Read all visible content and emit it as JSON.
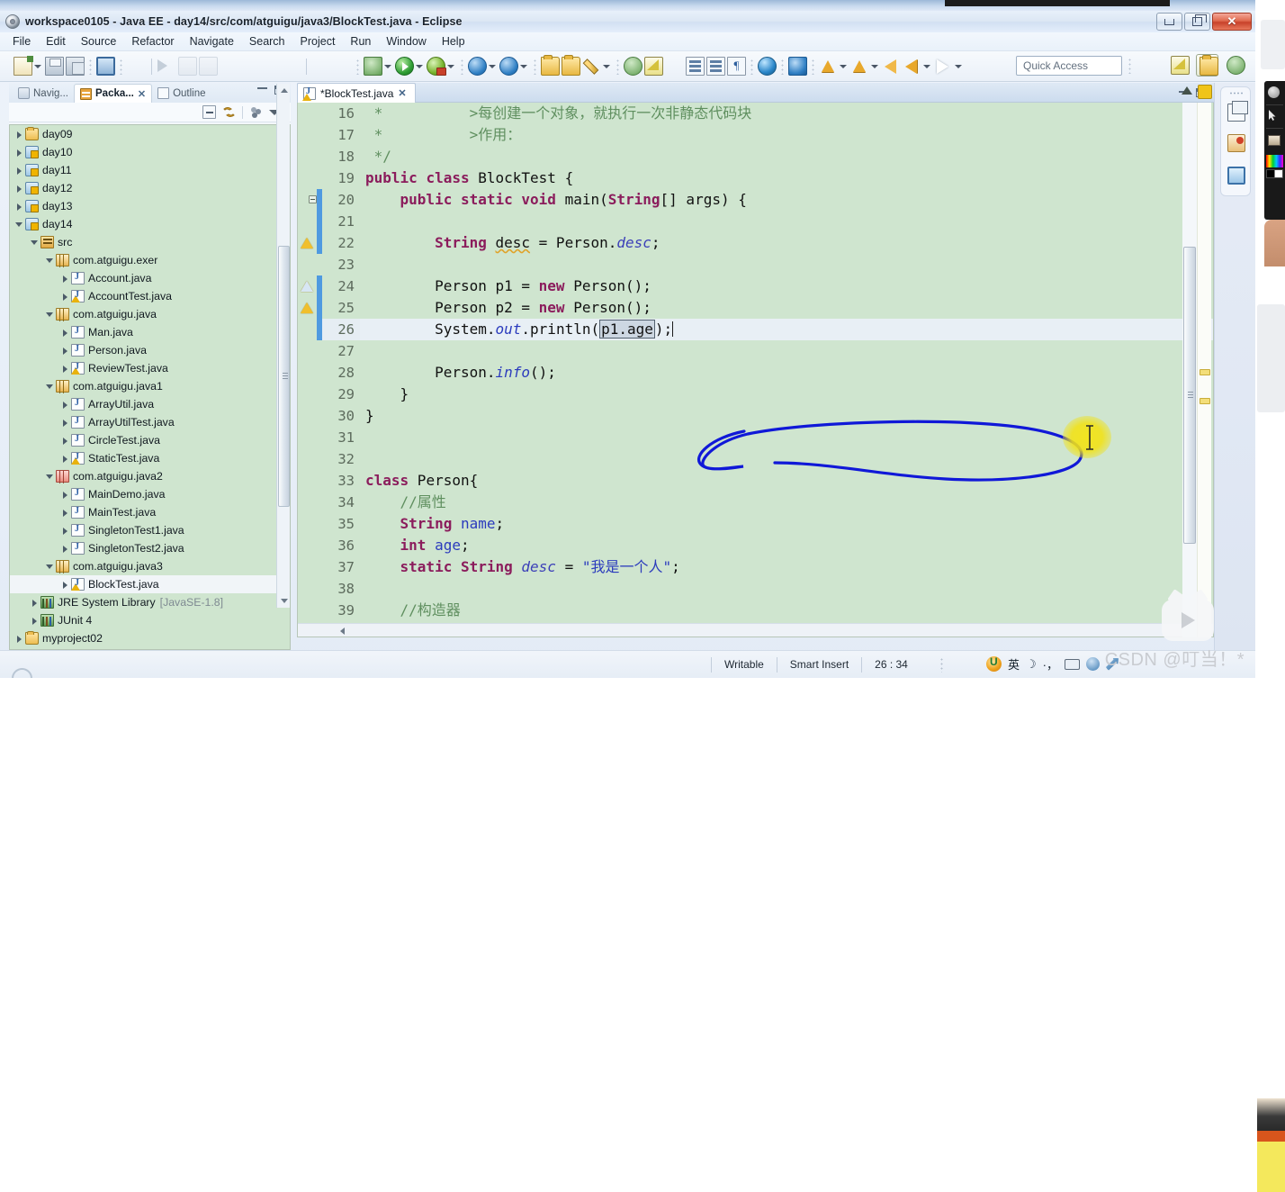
{
  "window": {
    "title": "workspace0105 - Java EE - day14/src/com/atguigu/java3/BlockTest.java - Eclipse",
    "icon": "eclipse-icon",
    "buttons": {
      "minimize": "minimize-icon",
      "maximize": "maximize-icon",
      "close": "✕"
    }
  },
  "menubar": {
    "items": [
      "File",
      "Edit",
      "Source",
      "Refactor",
      "Navigate",
      "Search",
      "Project",
      "Run",
      "Window",
      "Help"
    ]
  },
  "toolbar": {
    "quick_access_placeholder": "Quick Access",
    "icons": [
      "new-wizard-icon",
      "save-icon",
      "save-all-icon",
      "open-console-icon",
      "skip-breakpoints-icon",
      "resume-icon",
      "suspend-icon",
      "terminate-icon",
      "step-into-icon",
      "step-over-icon",
      "step-return-icon",
      "drop-to-frame-icon",
      "open-type-icon",
      "new-java-class-icon",
      "external-tools-icon",
      "run-icon",
      "debug-icon",
      "coverage-icon",
      "search-icon",
      "open-resource-icon",
      "open-folder-icon",
      "pencil-icon",
      "previous-annotation-icon",
      "annotation-icon",
      "next-edit-icon",
      "bookmark-icon",
      "open-perspective-icon",
      "toggle-markers-icon",
      "web-browser-icon",
      "export-icon",
      "last-edit-icon",
      "back-icon",
      "forward-icon"
    ],
    "perspective_buttons": [
      "open-perspective-icon",
      "java-ee-perspective-icon",
      "debug-perspective-icon"
    ]
  },
  "left_panel": {
    "tabs": [
      {
        "label": "Navig...",
        "icon": "navigator-icon",
        "active": false
      },
      {
        "label": "Packa...",
        "icon": "package-explorer-icon",
        "active": true,
        "close": "✕"
      },
      {
        "label": "Outline",
        "icon": "outline-icon",
        "active": false
      }
    ],
    "view_toolbar": [
      "collapse-all-icon",
      "link-with-editor-icon",
      "view-menu-dots-icon",
      "view-menu-icon"
    ],
    "tree": [
      {
        "indent": 0,
        "twist": "closed",
        "icon": "folder-icon",
        "label": "day09"
      },
      {
        "indent": 0,
        "twist": "closed",
        "icon": "project-icon",
        "label": "day10"
      },
      {
        "indent": 0,
        "twist": "closed",
        "icon": "project-icon",
        "label": "day11"
      },
      {
        "indent": 0,
        "twist": "closed",
        "icon": "project-icon",
        "label": "day12"
      },
      {
        "indent": 0,
        "twist": "closed",
        "icon": "project-icon",
        "label": "day13"
      },
      {
        "indent": 0,
        "twist": "open",
        "icon": "project-icon",
        "label": "day14"
      },
      {
        "indent": 1,
        "twist": "open",
        "icon": "source-folder-icon",
        "label": "src"
      },
      {
        "indent": 2,
        "twist": "open",
        "icon": "package-icon",
        "label": "com.atguigu.exer"
      },
      {
        "indent": 3,
        "twist": "closed",
        "icon": "java-file-icon",
        "label": "Account.java"
      },
      {
        "indent": 3,
        "twist": "closed",
        "icon": "java-file-warn-icon",
        "label": "AccountTest.java"
      },
      {
        "indent": 2,
        "twist": "open",
        "icon": "package-icon",
        "label": "com.atguigu.java"
      },
      {
        "indent": 3,
        "twist": "closed",
        "icon": "java-file-icon",
        "label": "Man.java"
      },
      {
        "indent": 3,
        "twist": "closed",
        "icon": "java-file-icon",
        "label": "Person.java"
      },
      {
        "indent": 3,
        "twist": "closed",
        "icon": "java-file-warn-icon",
        "label": "ReviewTest.java"
      },
      {
        "indent": 2,
        "twist": "open",
        "icon": "package-icon",
        "label": "com.atguigu.java1"
      },
      {
        "indent": 3,
        "twist": "closed",
        "icon": "java-file-icon",
        "label": "ArrayUtil.java"
      },
      {
        "indent": 3,
        "twist": "closed",
        "icon": "java-file-icon",
        "label": "ArrayUtilTest.java"
      },
      {
        "indent": 3,
        "twist": "closed",
        "icon": "java-file-icon",
        "label": "CircleTest.java"
      },
      {
        "indent": 3,
        "twist": "closed",
        "icon": "java-file-warn-icon",
        "label": "StaticTest.java"
      },
      {
        "indent": 2,
        "twist": "open",
        "icon": "package-plain-icon",
        "label": "com.atguigu.java2"
      },
      {
        "indent": 3,
        "twist": "closed",
        "icon": "java-file-icon",
        "label": "MainDemo.java"
      },
      {
        "indent": 3,
        "twist": "closed",
        "icon": "java-file-icon",
        "label": "MainTest.java"
      },
      {
        "indent": 3,
        "twist": "closed",
        "icon": "java-file-icon",
        "label": "SingletonTest1.java"
      },
      {
        "indent": 3,
        "twist": "closed",
        "icon": "java-file-icon",
        "label": "SingletonTest2.java"
      },
      {
        "indent": 2,
        "twist": "open",
        "icon": "package-icon",
        "label": "com.atguigu.java3"
      },
      {
        "indent": 3,
        "twist": "closed",
        "icon": "java-file-warn-icon",
        "label": "BlockTest.java",
        "selected": true
      },
      {
        "indent": 1,
        "twist": "closed",
        "icon": "library-icon",
        "label": "JRE System Library",
        "dim": "[JavaSE-1.8]"
      },
      {
        "indent": 1,
        "twist": "closed",
        "icon": "library-icon",
        "label": "JUnit 4"
      },
      {
        "indent": 0,
        "twist": "closed",
        "icon": "folder-icon",
        "label": "myproject02"
      }
    ]
  },
  "editor": {
    "tab": {
      "label": "*BlockTest.java",
      "icon": "java-file-warn-icon",
      "close": "✕"
    },
    "first_line": 16,
    "lines": [
      {
        "n": 16,
        "marker": "",
        "text": " *          >每创建一个对象，就执行一次非静态代码块",
        "style": "comment"
      },
      {
        "n": 17,
        "marker": "",
        "text": " *          >作用：",
        "style": "comment"
      },
      {
        "n": 18,
        "marker": "",
        "text": " */",
        "style": "comment"
      },
      {
        "n": 19,
        "marker": "",
        "text": "public class BlockTest {",
        "style": "code"
      },
      {
        "n": 20,
        "marker": "fold",
        "text": "    public static void main(String[] args) {",
        "style": "code"
      },
      {
        "n": 21,
        "marker": "",
        "text": "",
        "style": "code"
      },
      {
        "n": 22,
        "marker": "warn",
        "text": "        String desc = Person.desc;",
        "style": "code"
      },
      {
        "n": 23,
        "marker": "",
        "text": "",
        "style": "code"
      },
      {
        "n": 24,
        "marker": "warn-blue",
        "text": "        Person p1 = new Person();",
        "style": "code"
      },
      {
        "n": 25,
        "marker": "warn",
        "text": "        Person p2 = new Person();",
        "style": "code"
      },
      {
        "n": 26,
        "marker": "",
        "text": "        System.out.println(p1.age);",
        "style": "code",
        "current": true
      },
      {
        "n": 27,
        "marker": "",
        "text": "",
        "style": "code"
      },
      {
        "n": 28,
        "marker": "",
        "text": "        Person.info();",
        "style": "code"
      },
      {
        "n": 29,
        "marker": "",
        "text": "    }",
        "style": "code"
      },
      {
        "n": 30,
        "marker": "",
        "text": "}",
        "style": "code"
      },
      {
        "n": 31,
        "marker": "",
        "text": "",
        "style": "code"
      },
      {
        "n": 32,
        "marker": "",
        "text": "",
        "style": "code"
      },
      {
        "n": 33,
        "marker": "",
        "text": "class Person{",
        "style": "code"
      },
      {
        "n": 34,
        "marker": "",
        "text": "    //属性",
        "style": "comment"
      },
      {
        "n": 35,
        "marker": "",
        "text": "    String name;",
        "style": "code"
      },
      {
        "n": 36,
        "marker": "",
        "text": "    int age;",
        "style": "code"
      },
      {
        "n": 37,
        "marker": "",
        "text": "    static String desc = \"我是一个人\";",
        "style": "code"
      },
      {
        "n": 38,
        "marker": "",
        "text": "",
        "style": "code"
      },
      {
        "n": 39,
        "marker": "",
        "text": "    //构造器",
        "style": "comment"
      }
    ],
    "selection": "p1.age",
    "annotation": "blue-hand-drawn-oval",
    "cursor_highlight": "yellow-cursor-highlight"
  },
  "right_bar": {
    "buttons": [
      {
        "name": "restore-window-icon"
      },
      {
        "name": "debug-perspective-icon"
      },
      {
        "name": "java-ee-perspective-icon",
        "active": true
      }
    ]
  },
  "statusbar": {
    "writable": "Writable",
    "insert_mode": "Smart Insert",
    "position": "26 : 34",
    "ime": {
      "logo": "sogou-ime-icon",
      "lang": "英",
      "moon": "☽",
      "punct": "·，",
      "keyboard": "keyboard-icon",
      "toolbox": "toolbox-icon",
      "wrench": "wrench-icon"
    }
  },
  "watermarks": {
    "csdn": "CSDN @叮当！*",
    "bilibili": "bilibili-play-icon"
  },
  "overlay": {
    "annotation_toolbar": "screen-annotation-toolbar",
    "colors": {
      "accent_orange": "#e87a16",
      "annotation_blue": "#1018d8",
      "editor_bg": "#cfe5cf",
      "highlight_yellow": "#f2e214"
    }
  }
}
